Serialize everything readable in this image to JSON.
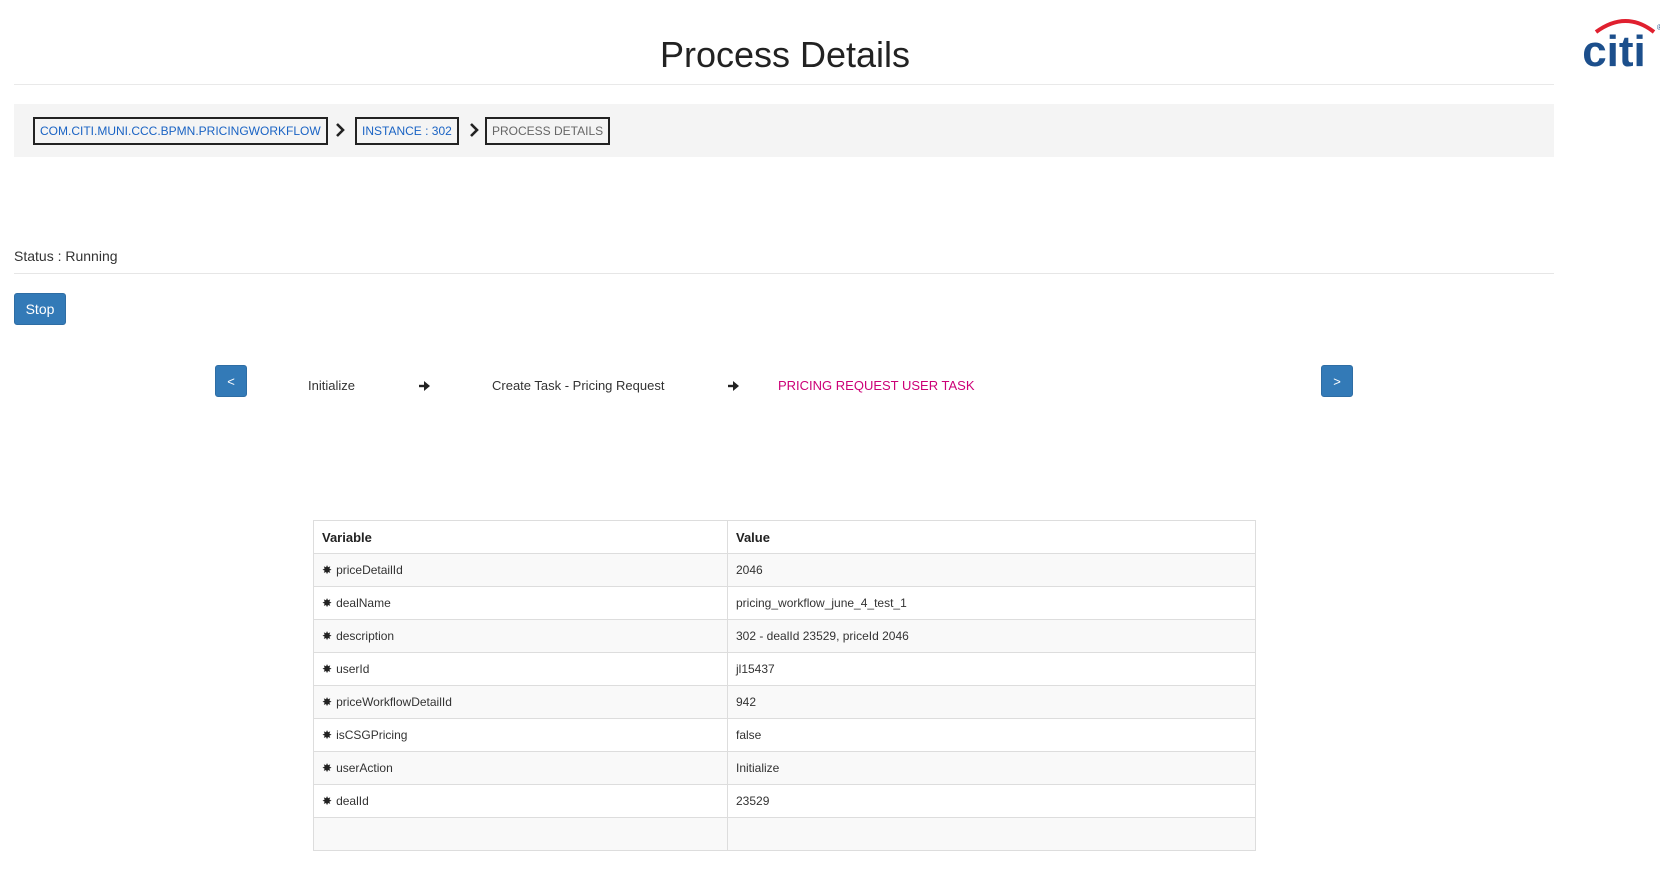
{
  "header": {
    "title": "Process Details",
    "logo_text": "citi",
    "logo_colors": {
      "text": "#1c4f8c",
      "arc": "#e0202f"
    }
  },
  "breadcrumb": {
    "items": [
      {
        "label": "COM.CITI.MUNI.CCC.BPMN.PRICINGWORKFLOW",
        "state": "link"
      },
      {
        "label": "INSTANCE : 302",
        "state": "link"
      },
      {
        "label": "PROCESS DETAILS",
        "state": "current"
      }
    ],
    "separator_icon": "chevron-right-icon"
  },
  "status": {
    "text": "Status : Running"
  },
  "actions": {
    "stop_label": "Stop"
  },
  "workflow": {
    "prev_label": "<",
    "next_label": ">",
    "steps": [
      {
        "label": "Initialize",
        "state": "done"
      },
      {
        "label": "Create Task - Pricing Request",
        "state": "done"
      },
      {
        "label": "PRICING REQUEST USER TASK",
        "state": "current"
      }
    ],
    "arrow_icon": "arrow-right-icon"
  },
  "variables": {
    "headers": {
      "variable": "Variable",
      "value": "Value"
    },
    "row_icon": "asterisk-icon",
    "rows": [
      {
        "variable": "priceDetailId",
        "value": "2046"
      },
      {
        "variable": "dealName",
        "value": "pricing_workflow_june_4_test_1"
      },
      {
        "variable": "description",
        "value": "302 - dealId 23529, priceId 2046"
      },
      {
        "variable": "userId",
        "value": "jl15437"
      },
      {
        "variable": "priceWorkflowDetailId",
        "value": "942"
      },
      {
        "variable": "isCSGPricing",
        "value": "false"
      },
      {
        "variable": "userAction",
        "value": "Initialize"
      },
      {
        "variable": "dealId",
        "value": "23529"
      }
    ]
  },
  "colors": {
    "primary_button": "#337ab7",
    "breadcrumb_link": "#1a63c4",
    "current_step": "#cc0077"
  }
}
